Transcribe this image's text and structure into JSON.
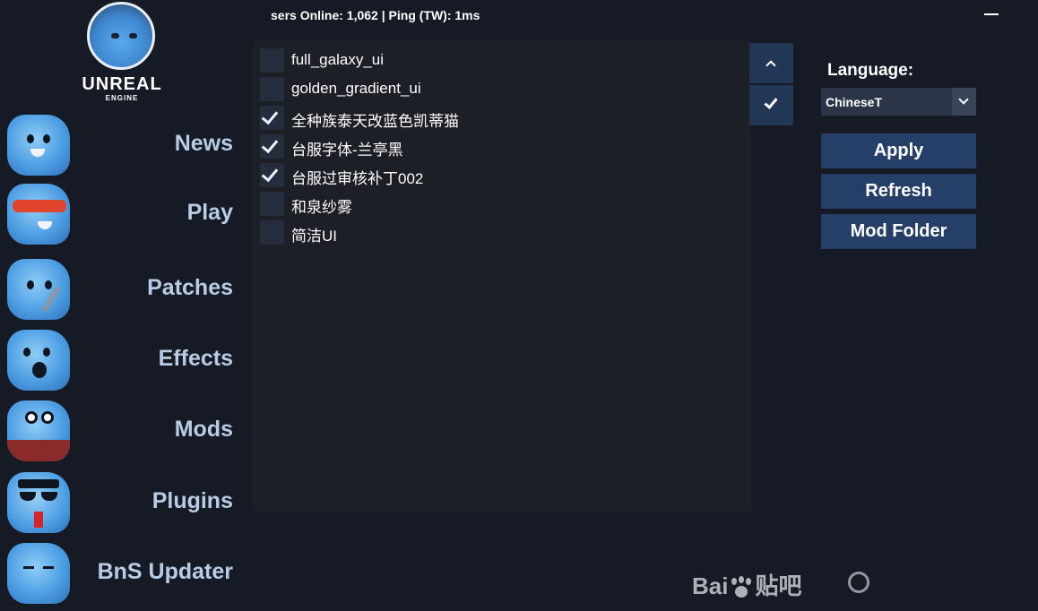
{
  "status_bar": {
    "text": "sers Online: 1,062   |   Ping (TW): 1ms"
  },
  "logo": {
    "title": "UNREAL",
    "subtitle": "ENGINE"
  },
  "sidebar": {
    "items": [
      {
        "label": "News",
        "icon": "shark-happy-icon"
      },
      {
        "label": "Play",
        "icon": "shark-sunglasses-icon"
      },
      {
        "label": "Patches",
        "icon": "shark-knife-icon"
      },
      {
        "label": "Effects",
        "icon": "shark-surprised-icon"
      },
      {
        "label": "Mods",
        "icon": "shark-suit-icon"
      },
      {
        "label": "Plugins",
        "icon": "shark-shades-icon"
      },
      {
        "label": "BnS Updater",
        "icon": "shark-sleep-icon"
      }
    ]
  },
  "mods": [
    {
      "name": "full_galaxy_ui",
      "checked": false
    },
    {
      "name": "golden_gradient_ui",
      "checked": false
    },
    {
      "name": "全种族泰天改蓝色凯蒂猫",
      "checked": true
    },
    {
      "name": "台服字体-兰亭黑",
      "checked": true
    },
    {
      "name": "台服过审核补丁002",
      "checked": true
    },
    {
      "name": "和泉纱雾",
      "checked": false
    },
    {
      "name": "简洁UI",
      "checked": false
    }
  ],
  "controls": {
    "language_label": "Language:",
    "language_value": "ChineseT",
    "apply_label": "Apply",
    "refresh_label": "Refresh",
    "mod_folder_label": "Mod Folder"
  },
  "watermark": {
    "text_left": "Bai",
    "text_right": "贴吧"
  },
  "colors": {
    "background": "#151a24",
    "panel": "#1c1f26",
    "button": "#253f68",
    "nav_label": "#b8cce6"
  }
}
